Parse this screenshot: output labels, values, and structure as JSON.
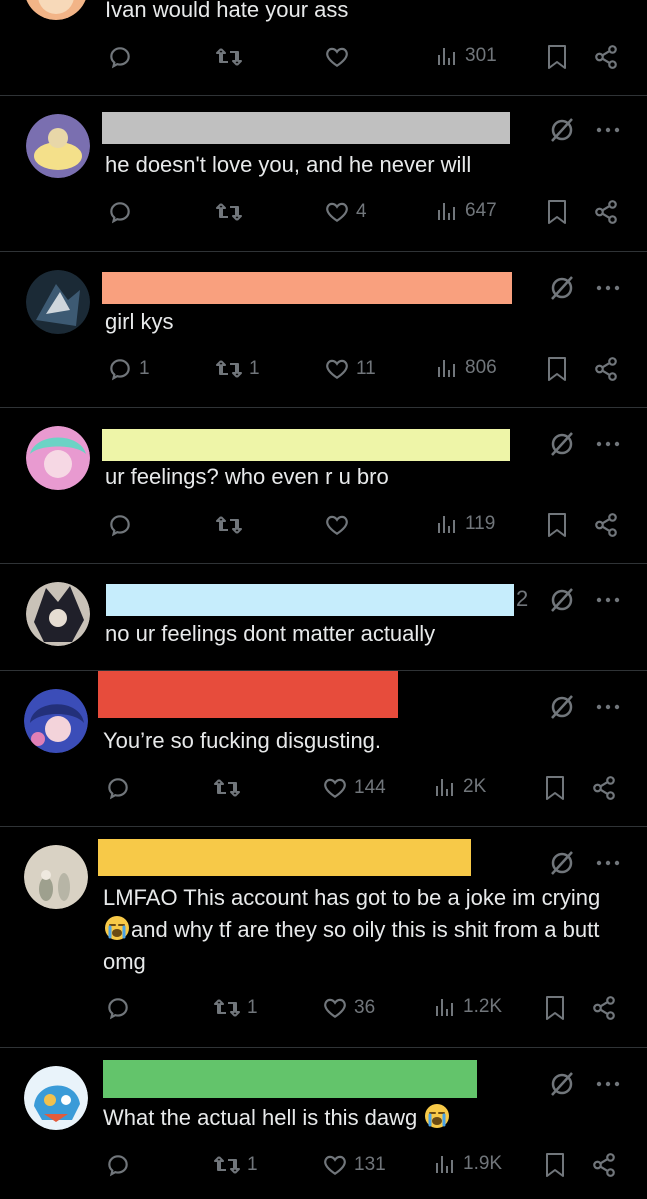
{
  "colors": {
    "background": "#000000",
    "text": "#e7e9ea",
    "muted": "#71767b",
    "divider": "#2f3336"
  },
  "posts": [
    {
      "text": "Ivan would hate your ass",
      "redaction_color": null,
      "avatar_colors": [
        "#f2b487",
        "#f7d9b9"
      ],
      "reply_count": "",
      "repost_count": "",
      "like_count": "",
      "view_count": "301"
    },
    {
      "text": "he doesn't love you, and he never will",
      "redaction_color": "#c0c0c0",
      "avatar_colors": [
        "#7a6fb0",
        "#f4e08a"
      ],
      "reply_count": "",
      "repost_count": "",
      "like_count": "4",
      "view_count": "647"
    },
    {
      "text": "girl kys",
      "redaction_color": "#f9a07e",
      "avatar_colors": [
        "#1b2a36",
        "#3d5a73"
      ],
      "reply_count": "1",
      "repost_count": "1",
      "like_count": "11",
      "view_count": "806"
    },
    {
      "text": "ur feelings? who even r u bro",
      "redaction_color": "#eef5a8",
      "avatar_colors": [
        "#6bd3c5",
        "#e89ad0"
      ],
      "reply_count": "",
      "repost_count": "",
      "like_count": "",
      "view_count": "119"
    },
    {
      "text": "no ur feelings dont matter actually",
      "redaction_color": "#c6edfc",
      "handle_fragment": "2",
      "avatar_colors": [
        "#20202a",
        "#c9c2b8"
      ]
    },
    {
      "text": "You’re so fucking disgusting.",
      "redaction_color": "#e74c3c",
      "avatar_colors": [
        "#3b4db8",
        "#e07fb6"
      ],
      "reply_count": "",
      "repost_count": "",
      "like_count": "144",
      "view_count": "2K"
    },
    {
      "text_parts": [
        "LMFAO This account has got to be a joke im crying ",
        "and why tf are they so oily this is shit from a butt omg"
      ],
      "emoji": "loudly-crying-face",
      "redaction_color": "#f7c948",
      "avatar_colors": [
        "#9ea08e",
        "#d9d2c4"
      ],
      "reply_count": "",
      "repost_count": "1",
      "like_count": "36",
      "view_count": "1.2K"
    },
    {
      "text_parts": [
        "What the actual hell is this dawg "
      ],
      "emoji": "loudly-crying-face",
      "redaction_color": "#63c46b",
      "avatar_colors": [
        "#3a9bd8",
        "#f2c14e"
      ],
      "reply_count": "",
      "repost_count": "1",
      "like_count": "131",
      "view_count": "1.9K"
    }
  ]
}
